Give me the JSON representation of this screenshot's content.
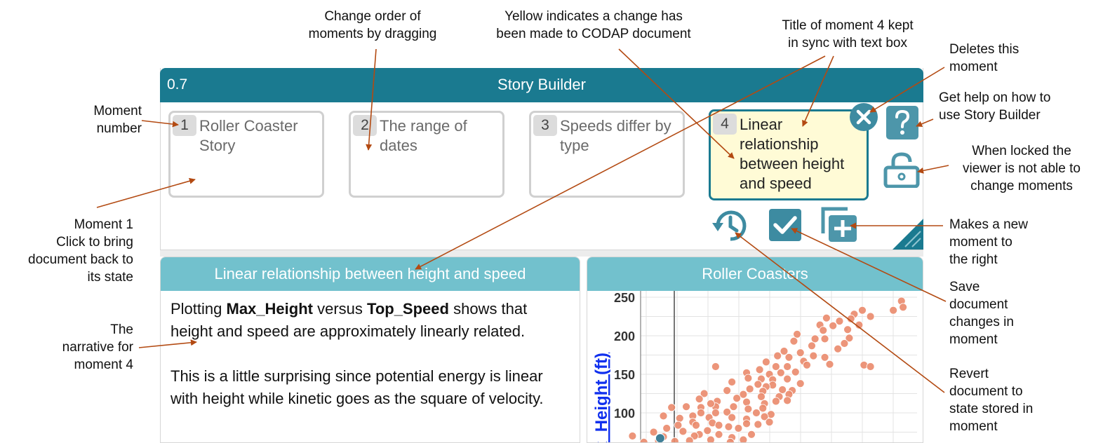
{
  "annotations": {
    "change_order": [
      "Change order of",
      "moments by dragging"
    ],
    "yellow": [
      "Yellow indicates a change has",
      "been made to CODAP document"
    ],
    "title_sync": [
      "Title of moment 4 kept",
      "in sync with text box"
    ],
    "deletes": [
      "Deletes this",
      "moment"
    ],
    "help": [
      "Get help on how to",
      "use Story Builder"
    ],
    "locked": [
      "When locked the",
      "viewer is not able to",
      "change moments"
    ],
    "moment_number": [
      "Moment",
      "number"
    ],
    "moment1": [
      "Moment 1",
      "Click to bring",
      "document back to",
      "its state"
    ],
    "new_moment": [
      "Makes a new",
      "moment to",
      "the right"
    ],
    "save": [
      "Save",
      "document",
      "changes in",
      "moment"
    ],
    "narrative": [
      "The",
      "narrative for",
      "moment 4"
    ],
    "revert": [
      "Revert",
      "document to",
      "state stored in",
      "moment"
    ]
  },
  "story_builder": {
    "version": "0.7",
    "title": "Story Builder",
    "moments": [
      {
        "number": "1",
        "title": "Roller Coaster Story"
      },
      {
        "number": "2",
        "title": "The range of dates"
      },
      {
        "number": "3",
        "title": "Speeds differ by type"
      },
      {
        "number": "4",
        "title": "Linear relationship between height and speed"
      }
    ],
    "active_moment": 4
  },
  "narrative": {
    "title": "Linear relationship between height and speed",
    "p1_a": "Plotting ",
    "p1_b": "Max_Height",
    "p1_c": " versus ",
    "p1_d": "Top_Speed",
    "p1_e": " shows that height and speed are approximately linearly related.",
    "p2": "This is a little surprising since potential energy is linear with height while kinetic goes as the square of velocity."
  },
  "graph": {
    "title": "Roller Coasters",
    "y_axis_label": "x_Height (ft)"
  },
  "chart_data": {
    "type": "scatter",
    "title": "Roller Coasters",
    "ylabel": "x_Height (ft)",
    "ylim": [
      60,
      255
    ],
    "yticks": [
      "250",
      "200",
      "150",
      "100"
    ],
    "point_color": "#ea8a6c",
    "highlight_color": "#3f7f97",
    "points": [
      [
        245,
        245
      ],
      [
        246,
        237
      ],
      [
        240,
        233
      ],
      [
        221,
        233
      ],
      [
        226,
        225
      ],
      [
        216,
        228
      ],
      [
        214,
        222
      ],
      [
        219,
        214
      ],
      [
        207,
        219
      ],
      [
        199,
        223
      ],
      [
        212,
        208
      ],
      [
        203,
        213
      ],
      [
        195,
        214
      ],
      [
        197,
        207
      ],
      [
        213,
        197
      ],
      [
        210,
        190
      ],
      [
        198,
        196
      ],
      [
        206,
        183
      ],
      [
        192,
        196
      ],
      [
        190,
        187
      ],
      [
        181,
        202
      ],
      [
        179,
        193
      ],
      [
        183,
        178
      ],
      [
        191,
        174
      ],
      [
        198,
        172
      ],
      [
        201,
        163
      ],
      [
        222,
        162
      ],
      [
        226,
        160
      ],
      [
        185,
        167
      ],
      [
        176,
        172
      ],
      [
        173,
        180
      ],
      [
        169,
        174
      ],
      [
        187,
        162
      ],
      [
        175,
        160
      ],
      [
        180,
        153
      ],
      [
        168,
        160
      ],
      [
        171,
        152
      ],
      [
        162,
        166
      ],
      [
        158,
        156
      ],
      [
        164,
        150
      ],
      [
        166,
        143
      ],
      [
        175,
        144
      ],
      [
        183,
        138
      ],
      [
        159,
        144
      ],
      [
        150,
        152
      ],
      [
        151,
        145
      ],
      [
        166,
        136
      ],
      [
        162,
        134
      ],
      [
        172,
        130
      ],
      [
        178,
        129
      ],
      [
        157,
        137
      ],
      [
        176,
        124
      ],
      [
        160,
        128
      ],
      [
        170,
        121
      ],
      [
        159,
        121
      ],
      [
        152,
        131
      ],
      [
        148,
        124
      ],
      [
        141,
        140
      ],
      [
        138,
        129
      ],
      [
        131,
        160
      ],
      [
        124,
        125
      ],
      [
        132,
        115
      ],
      [
        144,
        119
      ],
      [
        150,
        114
      ],
      [
        161,
        112
      ],
      [
        168,
        115
      ],
      [
        175,
        116
      ],
      [
        160,
        106
      ],
      [
        151,
        105
      ],
      [
        142,
        108
      ],
      [
        131,
        108
      ],
      [
        122,
        107
      ],
      [
        121,
        118
      ],
      [
        128,
        112
      ],
      [
        156,
        100
      ],
      [
        165,
        98
      ],
      [
        138,
        101
      ],
      [
        131,
        100
      ],
      [
        122,
        100
      ],
      [
        113,
        108
      ],
      [
        117,
        96
      ],
      [
        127,
        94
      ],
      [
        141,
        94
      ],
      [
        150,
        92
      ],
      [
        161,
        95
      ],
      [
        104,
        107
      ],
      [
        99,
        96
      ],
      [
        109,
        93
      ],
      [
        117,
        88
      ],
      [
        129,
        87
      ],
      [
        133,
        84
      ],
      [
        150,
        86
      ],
      [
        157,
        85
      ],
      [
        164,
        88
      ],
      [
        108,
        84
      ],
      [
        119,
        84
      ],
      [
        139,
        82
      ],
      [
        145,
        80
      ],
      [
        101,
        80
      ],
      [
        80,
        70
      ],
      [
        93,
        75
      ],
      [
        111,
        76
      ],
      [
        126,
        77
      ],
      [
        121,
        72
      ],
      [
        118,
        70
      ],
      [
        99,
        69
      ],
      [
        133,
        72
      ],
      [
        141,
        68
      ],
      [
        153,
        72
      ],
      [
        148,
        65
      ],
      [
        128,
        65
      ],
      [
        115,
        64
      ],
      [
        106,
        63
      ],
      [
        87,
        62
      ],
      [
        96,
        64
      ],
      [
        140,
        62
      ]
    ],
    "highlight_points": [
      [
        97,
        67
      ]
    ]
  }
}
